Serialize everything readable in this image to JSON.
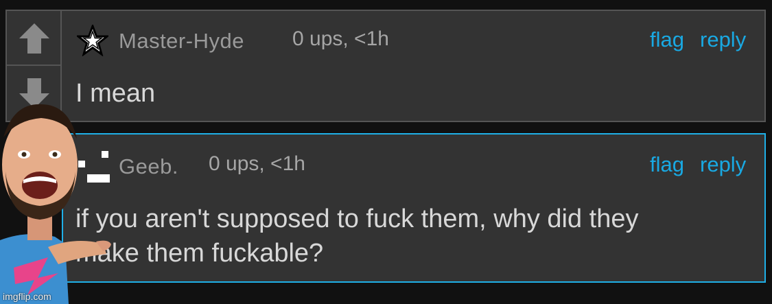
{
  "comments": [
    {
      "username": "Master-Hyde",
      "meta": "0 ups, <1h",
      "flag_label": "flag",
      "reply_label": "reply",
      "body": "I mean",
      "avatar_icon": "star-icon"
    },
    {
      "username": "Geeb.",
      "meta": "0 ups, <1h",
      "flag_label": "flag",
      "reply_label": "reply",
      "body_line1": "if you aren't supposed to fuck them, why did they",
      "body_line2": "make them fuckable?",
      "avatar_icon": "pixel-face-icon"
    }
  ],
  "vote_icons": [
    "upvote-arrow-icon",
    "downvote-arrow-icon"
  ],
  "watermark": "imgflip.com",
  "colors": {
    "background": "#111111",
    "panel": "#333333",
    "panel_border": "#555555",
    "highlight_border": "#1fb0e8",
    "link": "#19a9e3",
    "username": "#9a9a9a",
    "body_text": "#d8d8d8"
  }
}
